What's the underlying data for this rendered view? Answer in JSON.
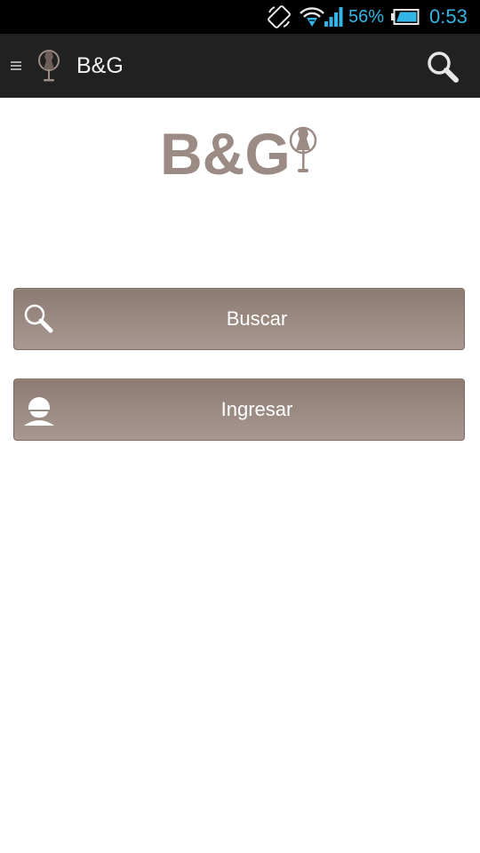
{
  "status_bar": {
    "battery_percent": "56%",
    "time": "0:53",
    "icons": [
      "screen-rotate-icon",
      "wifi-icon",
      "signal-icon",
      "battery-icon"
    ],
    "accent_color": "#33b5e5"
  },
  "action_bar": {
    "title": "B&G",
    "icons": [
      "menu-icon",
      "app-logo-icon",
      "search-icon"
    ]
  },
  "logo": {
    "text": "B&G",
    "color": "#9c8b84"
  },
  "buttons": [
    {
      "label": "Buscar",
      "icon": "search-icon"
    },
    {
      "label": "Ingresar",
      "icon": "user-icon"
    }
  ],
  "colors": {
    "button_top": "#8d7b72",
    "button_bottom": "#a89891",
    "action_bar": "#212121"
  }
}
